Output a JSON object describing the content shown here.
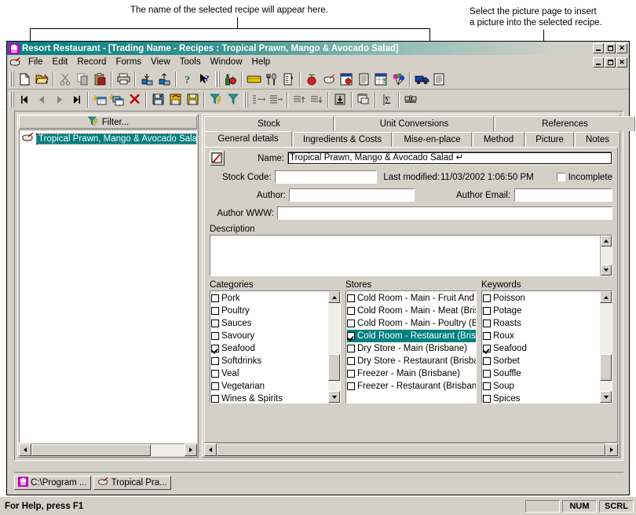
{
  "annotations": [
    {
      "id": "a1",
      "text": "The name of the selected recipe will appear here."
    },
    {
      "id": "a2",
      "line1": "Select the picture page to insert",
      "line2": "a picture into the selected recipe."
    }
  ],
  "window": {
    "title": "Resort Restaurant - [Trading Name - Recipes : Tropical Prawn, Mango & Avocado Salad]",
    "icon": "chef-hat-icon",
    "controls": {
      "minimize": "minimize-button",
      "restore": "restore-button",
      "close": "close-button"
    }
  },
  "menubar": {
    "doc_icon": "recipe-pot-icon",
    "items": [
      {
        "label": "File"
      },
      {
        "label": "Edit"
      },
      {
        "label": "Record"
      },
      {
        "label": "Forms"
      },
      {
        "label": "View"
      },
      {
        "label": "Tools"
      },
      {
        "label": "Window"
      },
      {
        "label": "Help"
      }
    ]
  },
  "toolbar_main": {
    "groups": [
      [
        "new-document-icon",
        "open-folder-icon"
      ],
      [
        "cut-icon",
        "copy-icon",
        "paste-icon"
      ],
      [
        "print-icon"
      ],
      [
        "send-to-back-icon",
        "bring-to-front-icon"
      ],
      [
        "help-icon",
        "context-help-icon"
      ],
      [
        "beverages-icon",
        "stock-box-icon",
        "cutlery-icon",
        "measure-jug-icon"
      ],
      [
        "produce-icon",
        "mixing-bowl-icon",
        "ingredient-list-icon",
        "document-icon",
        "costing-sheet-icon",
        "balloons-icon"
      ],
      [
        "delivery-truck-icon",
        "report-icon"
      ]
    ]
  },
  "toolbar_record": {
    "groups": [
      [
        "first-record-icon",
        "previous-record-icon",
        "next-record-icon",
        "last-record-icon"
      ],
      [
        "new-record-icon",
        "duplicate-record-icon",
        "delete-record-icon"
      ],
      [
        "save-icon",
        "save-undo-icon",
        "save-close-icon"
      ],
      [
        "filter-lightning-icon",
        "filter-icon"
      ],
      [
        "indent-left-icon",
        "indent-right-icon"
      ],
      [
        "move-up-icon",
        "move-down-icon"
      ],
      [
        "insert-row-icon"
      ],
      [
        "properties-icon"
      ],
      [
        "sum-icon"
      ],
      [
        "balance-icon"
      ]
    ]
  },
  "tree_panel": {
    "filter_label": "Filter...",
    "filter_icon": "filter-lightning-icon",
    "items": [
      {
        "icon": "recipe-pot-icon",
        "label": "Tropical Prawn, Mango & Avocado Salad",
        "selected": true
      }
    ]
  },
  "tabs": {
    "top_row": [
      {
        "label": "Stock",
        "active": false
      },
      {
        "label": "Unit Conversions",
        "active": false
      },
      {
        "label": "References",
        "active": false
      }
    ],
    "bottom_row": [
      {
        "label": "General details",
        "active": true
      },
      {
        "label": "Ingredients & Costs",
        "active": false
      },
      {
        "label": "Mise-en-place",
        "active": false
      },
      {
        "label": "Method",
        "active": false
      },
      {
        "label": "Picture",
        "active": false
      },
      {
        "label": "Notes",
        "active": false
      }
    ]
  },
  "form": {
    "edit_button_icon": "edit-pencil-icon",
    "name": {
      "label": "Name:",
      "value": "Tropical Prawn, Mango & Avocado Salad ↵"
    },
    "stock_code": {
      "label": "Stock Code:",
      "value": ""
    },
    "last_modified": {
      "label": "Last modified:",
      "value": "11/03/2002 1:06:50 PM"
    },
    "incomplete": {
      "label": "Incomplete",
      "checked": false
    },
    "author": {
      "label": "Author:",
      "value": ""
    },
    "author_email": {
      "label": "Author Email:",
      "value": ""
    },
    "author_www": {
      "label": "Author WWW:",
      "value": ""
    },
    "description": {
      "label": "Description",
      "value": ""
    }
  },
  "lists": {
    "categories": {
      "caption": "Categories",
      "items": [
        {
          "label": "Pork",
          "checked": false,
          "selected": false
        },
        {
          "label": "Poultry",
          "checked": false,
          "selected": false
        },
        {
          "label": "Sauces",
          "checked": false,
          "selected": false
        },
        {
          "label": "Savoury",
          "checked": false,
          "selected": false
        },
        {
          "label": "Seafood",
          "checked": true,
          "selected": false
        },
        {
          "label": "Softdrinks",
          "checked": false,
          "selected": false
        },
        {
          "label": "Veal",
          "checked": false,
          "selected": false
        },
        {
          "label": "Vegetarian",
          "checked": false,
          "selected": false
        },
        {
          "label": "Wines & Spirits",
          "checked": false,
          "selected": false
        }
      ]
    },
    "stores": {
      "caption": "Stores",
      "items": [
        {
          "label": "Cold Room - Main - Fruit And Veg",
          "checked": false,
          "selected": false
        },
        {
          "label": "Cold Room - Main - Meat (Brisban",
          "checked": false,
          "selected": false
        },
        {
          "label": "Cold Room - Main - Poultry (Brisba",
          "checked": false,
          "selected": false
        },
        {
          "label": "Cold Room - Restaurant (Brisbane",
          "checked": true,
          "selected": true
        },
        {
          "label": "Dry Store - Main (Brisbane)",
          "checked": false,
          "selected": false
        },
        {
          "label": "Dry Store - Restaurant (Brisbane)",
          "checked": false,
          "selected": false
        },
        {
          "label": "Freezer - Main (Brisbane)",
          "checked": false,
          "selected": false
        },
        {
          "label": "Freezer - Restaurant (Brisbane)",
          "checked": false,
          "selected": false
        }
      ]
    },
    "keywords": {
      "caption": "Keywords",
      "items": [
        {
          "label": "Poisson",
          "checked": false,
          "selected": false
        },
        {
          "label": "Potage",
          "checked": false,
          "selected": false
        },
        {
          "label": "Roasts",
          "checked": false,
          "selected": false
        },
        {
          "label": "Roux",
          "checked": false,
          "selected": false
        },
        {
          "label": "Seafood",
          "checked": true,
          "selected": false
        },
        {
          "label": "Sorbet",
          "checked": false,
          "selected": false
        },
        {
          "label": "Souffle",
          "checked": false,
          "selected": false
        },
        {
          "label": "Soup",
          "checked": false,
          "selected": false
        },
        {
          "label": "Spices",
          "checked": false,
          "selected": false
        }
      ]
    }
  },
  "taskbar": {
    "buttons": [
      {
        "icon": "chef-hat-icon",
        "label": "C:\\Program ..."
      },
      {
        "icon": "recipe-pot-icon",
        "label": "Tropical Pra..."
      }
    ]
  },
  "statusbar": {
    "text": "For Help, press F1",
    "panes": [
      "",
      "NUM",
      "SCRL"
    ]
  },
  "colors": {
    "title_start": "#008080",
    "face": "#d4d0c8",
    "selection": "#008080",
    "selection_text": "#ffffff"
  }
}
